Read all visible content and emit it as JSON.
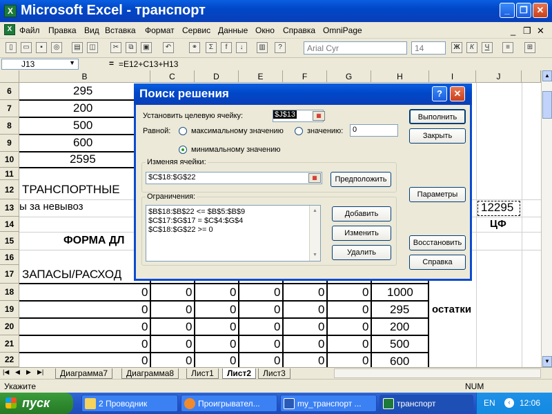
{
  "window": {
    "title": "Microsoft Excel - транспорт",
    "minimize": "_",
    "restore": "❐",
    "close": "✕"
  },
  "menu": [
    "Файл",
    "Правка",
    "Вид",
    "Вставка",
    "Формат",
    "Сервис",
    "Данные",
    "Окно",
    "Справка",
    "OmniPage"
  ],
  "toolbar": {
    "font": "Arial Cyr",
    "size": "14",
    "bold": "Ж",
    "italic": "К",
    "underline": "Ч"
  },
  "formula_bar": {
    "cell": "J13",
    "eq": "=",
    "formula": "=E12+C13+H13"
  },
  "columns": [
    "B",
    "C",
    "D",
    "E",
    "F",
    "G",
    "H",
    "I",
    "J"
  ],
  "rows": [
    "6",
    "7",
    "8",
    "9",
    "10",
    "11",
    "12",
    "13",
    "14",
    "15",
    "16",
    "17",
    "18",
    "19",
    "20",
    "21",
    "22"
  ],
  "cells": {
    "b6": "295",
    "b7": "200",
    "b8": "500",
    "b9": "600",
    "b10": "2595",
    "b12": "ТРАНСПОРТНЫЕ",
    "b13": "ы за невывоз",
    "b15": "ФОРМА ДЛ",
    "b17": "ЗАПАСЫ/РАСХОД",
    "j13": "12295",
    "j14": "ЦФ",
    "i19": "остатки",
    "h18": "1000",
    "h19": "295",
    "h20": "200",
    "h21": "500",
    "h22": "600",
    "zero": "0"
  },
  "sheet_tabs": [
    "Диаграмма7",
    "Диаграмма8",
    "Лист1",
    "Лист2",
    "Лист3"
  ],
  "active_tab": "Лист2",
  "status": {
    "left": "Укажите",
    "num": "NUM"
  },
  "dialog": {
    "title": "Поиск решения",
    "help": "?",
    "target_label": "Установить целевую ячейку:",
    "target_value": "$J$13",
    "equal_label": "Равной:",
    "opt_max": "максимальному значению",
    "opt_value": "значению:",
    "value_input": "0",
    "opt_min": "минимальному значению",
    "changing_label": "Изменяя ячейки:",
    "changing_value": "$C$18:$G$22",
    "guess": "Предположить",
    "constraints_label": "Ограничения:",
    "constraints": [
      "$B$18:$B$22 <= $B$5:$B$9",
      "$C$17:$G$17 = $C$4:$G$4",
      "$C$18:$G$22 >= 0"
    ],
    "add": "Добавить",
    "change": "Изменить",
    "delete": "Удалить",
    "solve": "Выполнить",
    "close": "Закрыть",
    "options": "Параметры",
    "reset": "Восстановить",
    "help_btn": "Справка"
  },
  "taskbar": {
    "start": "пуск",
    "tasks": [
      "2 Проводник",
      "Проигрывател...",
      "my_транспорт ...",
      "транспорт"
    ],
    "lang": "EN",
    "time": "12:06"
  }
}
